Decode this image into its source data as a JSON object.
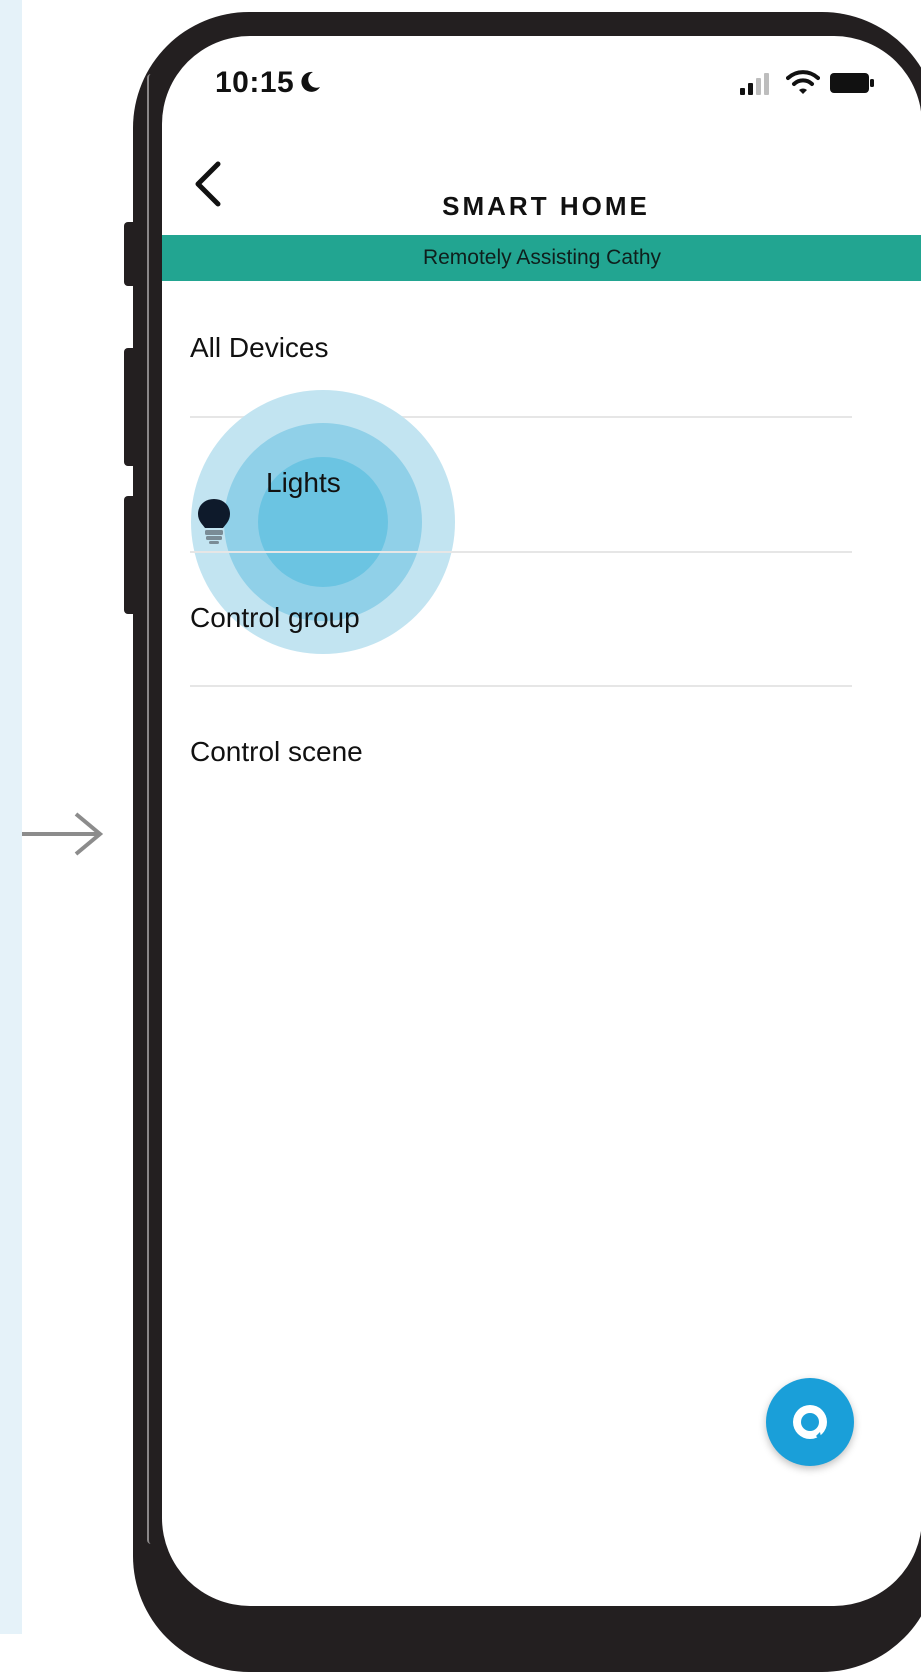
{
  "status_bar": {
    "time": "10:15",
    "icons": [
      "moon-icon",
      "signal-icon",
      "wifi-icon",
      "battery-icon"
    ]
  },
  "header": {
    "title": "SMART HOME",
    "back_icon": "chevron-left-icon"
  },
  "banner": {
    "text": "Remotely Assisting Cathy",
    "color": "#22a591"
  },
  "menu": {
    "items": [
      {
        "label": "All Devices"
      },
      {
        "label": "Lights",
        "icon": "light-bulb-icon",
        "state": "tapped"
      },
      {
        "label": "Control group"
      },
      {
        "label": "Control scene"
      }
    ]
  },
  "fab": {
    "icon": "alexa-icon",
    "color": "#1a9fd9"
  },
  "colors": {
    "accent": "#1a9fd9",
    "tap_ripple": "#6bc4e2",
    "frame": "#231f20",
    "left_strip": "#e5f2f9"
  }
}
